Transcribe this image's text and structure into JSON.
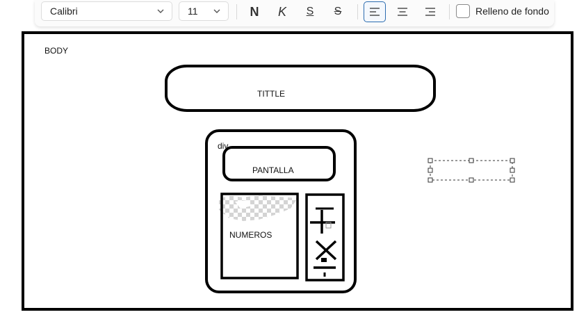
{
  "toolbar": {
    "font_family": "Calibri",
    "font_size": "11",
    "bold_label": "N",
    "italic_label": "K",
    "underline_label": "S",
    "strike_label": "S",
    "fill_checkbox_label": "Relleno de fondo",
    "fill_checked": false,
    "active_alignment": "left"
  },
  "drawing": {
    "body_label": "BODY",
    "title_label": "TITTLE",
    "div_label": "div",
    "screen_label": "PANTALLA",
    "numbers_label": "NUMEROS"
  }
}
